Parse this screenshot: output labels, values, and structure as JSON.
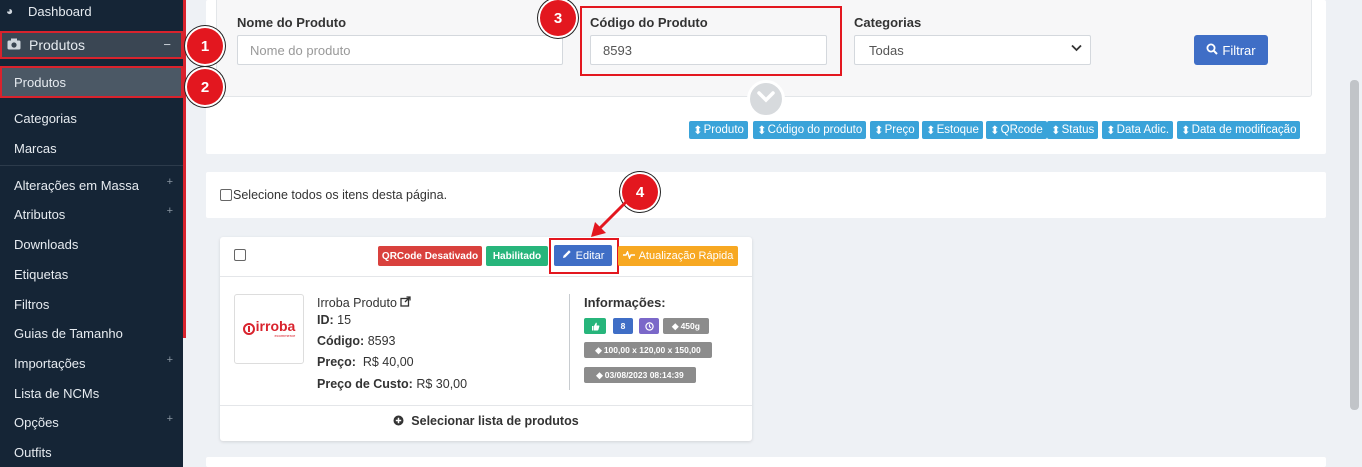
{
  "sidebar": {
    "top_item": "Dashboard",
    "section": "Produtos",
    "active_sub": "Produtos",
    "items": [
      {
        "label": "Categorias",
        "plus": false
      },
      {
        "label": "Marcas",
        "plus": false
      },
      {
        "label": "Alterações em Massa",
        "plus": true
      },
      {
        "label": "Atributos",
        "plus": true
      },
      {
        "label": "Downloads",
        "plus": false
      },
      {
        "label": "Etiquetas",
        "plus": false
      },
      {
        "label": "Filtros",
        "plus": false
      },
      {
        "label": "Guias de Tamanho",
        "plus": false
      },
      {
        "label": "Importações",
        "plus": true
      },
      {
        "label": "Lista de NCMs",
        "plus": false
      },
      {
        "label": "Opções",
        "plus": true
      },
      {
        "label": "Outfits",
        "plus": false
      }
    ],
    "plus_symbol": "+",
    "minus_symbol": "−"
  },
  "badges": [
    "1",
    "2",
    "3",
    "4"
  ],
  "filter": {
    "name_label": "Nome do Produto",
    "name_placeholder": "Nome do produto",
    "code_label": "Código do Produto",
    "code_value": "8593",
    "category_label": "Categorias",
    "category_value": "Todas",
    "filter_button": "Filtrar"
  },
  "sort_buttons": [
    "Produto",
    "Código do produto",
    "Preço",
    "Estoque",
    "QRcode",
    "Status",
    "Data Adic.",
    "Data de modificação"
  ],
  "select_all_text": "Selecione todos os itens desta página.",
  "product": {
    "tags": {
      "qrcode": "QRCode Desativado",
      "status": "Habilitado",
      "edit": "Editar",
      "quick": "Atualização Rápida"
    },
    "logo_text": "irroba",
    "logo_sub": "ecommerce",
    "name": "Irroba Produto",
    "id_label": "ID:",
    "id_value": "15",
    "code_label": "Código:",
    "code_value": "8593",
    "price_label": "Preço:",
    "price_value": "R$ 40,00",
    "cost_label": "Preço de Custo:",
    "cost_value": "R$ 30,00",
    "info_title": "Informações:",
    "info_count": "8",
    "info_weight": "450g",
    "info_dims": "100,00 x 120,00 x 150,00",
    "info_date": "03/08/2023 08:14:39",
    "select_list": "Selecionar lista de produtos"
  },
  "colors": {
    "sidebar_bg": "#152536",
    "highlight_red": "#e3171f",
    "primary_blue": "#3f6ec6",
    "sort_blue": "#3aa3d9",
    "tag_red": "#d9413d",
    "tag_green": "#27b57b",
    "tag_orange": "#f7a822"
  }
}
